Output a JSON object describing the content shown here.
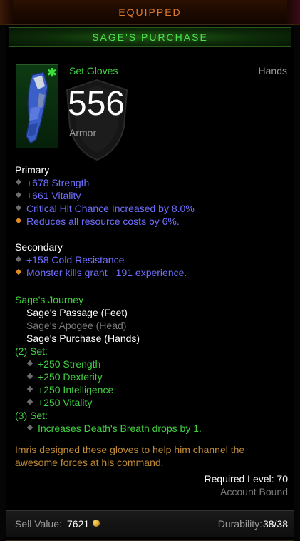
{
  "header": {
    "equipped_label": "EQUIPPED"
  },
  "item": {
    "name": "SAGE'S PURCHASE",
    "type": "Set Gloves",
    "slot": "Hands",
    "armor_value": "556",
    "armor_label": "Armor",
    "icon": "gloves-icon",
    "set_marker_icon": "green-star-icon"
  },
  "primary": {
    "heading": "Primary",
    "stats": [
      {
        "text": "+678 Strength",
        "bullet": "gray"
      },
      {
        "text": "+661 Vitality",
        "bullet": "gray"
      },
      {
        "text": "Critical Hit Chance Increased by 8.0%",
        "bullet": "gray"
      },
      {
        "text": "Reduces all resource costs by 6%.",
        "bullet": "orange"
      }
    ]
  },
  "secondary": {
    "heading": "Secondary",
    "stats": [
      {
        "text": "+158 Cold Resistance",
        "bullet": "gray"
      },
      {
        "text": "Monster kills grant +191 experience.",
        "bullet": "orange"
      }
    ]
  },
  "set": {
    "name": "Sage's Journey",
    "pieces": [
      {
        "text": "Sage's Passage (Feet)",
        "owned": true
      },
      {
        "text": "Sage's Apogee (Head)",
        "owned": false
      },
      {
        "text": "Sage's Purchase (Hands)",
        "owned": true
      }
    ],
    "bonus2_label": "(2) Set:",
    "bonus2": [
      "+250 Strength",
      "+250 Dexterity",
      "+250 Intelligence",
      "+250 Vitality"
    ],
    "bonus3_label": "(3) Set:",
    "bonus3": [
      "Increases Death's Breath drops by 1."
    ]
  },
  "flavor": {
    "line1": "Imris designed these gloves to help him channel the",
    "line2": "awesome forces at his command."
  },
  "requirements": {
    "level": "Required Level: 70",
    "binding": "Account Bound"
  },
  "footer": {
    "sell_label": "Sell Value:",
    "sell_value": "7621",
    "durability_label": "Durability:",
    "durability_value": "38/38"
  },
  "colors": {
    "set_green": "#41d041",
    "magic_blue": "#6f6fff",
    "legendary_orange": "#e07a2a",
    "flavor_gold": "#c08a35"
  }
}
